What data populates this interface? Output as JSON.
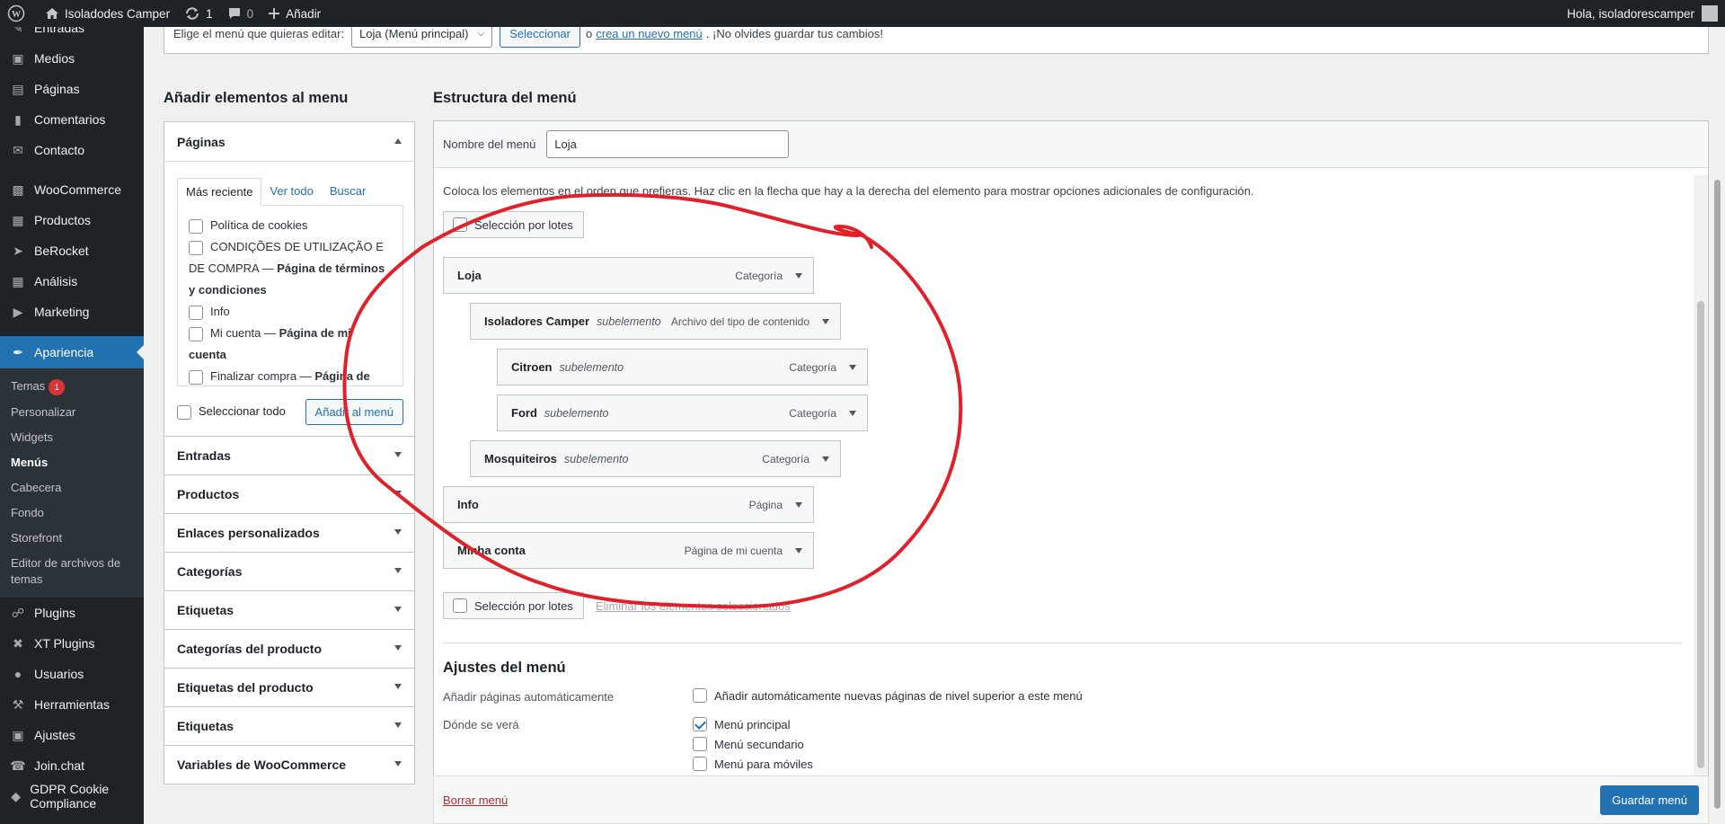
{
  "adminbar": {
    "site_name": "Isoladodes Camper",
    "updates_count": "1",
    "comments_count": "0",
    "new_label": "Añadir",
    "greeting": "Hola, isoladorescamper"
  },
  "sidebar": {
    "items_top": [
      {
        "label": "Entradas",
        "icon": "pin-icon"
      },
      {
        "label": "Medios",
        "icon": "media-icon"
      },
      {
        "label": "Páginas",
        "icon": "page-icon"
      },
      {
        "label": "Comentarios",
        "icon": "comment-icon"
      },
      {
        "label": "Contacto",
        "icon": "mail-icon"
      }
    ],
    "items_mid": [
      {
        "label": "WooCommerce",
        "icon": "woo-icon"
      },
      {
        "label": "Productos",
        "icon": "archive-icon"
      },
      {
        "label": "BeRocket",
        "icon": "rocket-icon"
      },
      {
        "label": "Análisis",
        "icon": "chart-icon"
      },
      {
        "label": "Marketing",
        "icon": "megaphone-icon"
      }
    ],
    "current": {
      "label": "Apariencia",
      "icon": "brush-icon"
    },
    "submenu": [
      {
        "label": "Temas",
        "badge": "1"
      },
      {
        "label": "Personalizar"
      },
      {
        "label": "Widgets"
      },
      {
        "label": "Menús"
      },
      {
        "label": "Cabecera"
      },
      {
        "label": "Fondo"
      },
      {
        "label": "Storefront"
      },
      {
        "label": "Editor de archivos de temas"
      }
    ],
    "items_bottom": [
      {
        "label": "Plugins",
        "icon": "plugin-icon"
      },
      {
        "label": "XT Plugins",
        "icon": "xt-icon"
      },
      {
        "label": "Usuarios",
        "icon": "user-icon"
      },
      {
        "label": "Herramientas",
        "icon": "wrench-icon"
      },
      {
        "label": "Ajustes",
        "icon": "settings-icon"
      },
      {
        "label": "Join.chat",
        "icon": "chat-icon"
      },
      {
        "label": "GDPR Cookie Compliance",
        "icon": "gdpr-icon"
      }
    ]
  },
  "topbox": {
    "prompt": "Elige el menú que quieras editar:",
    "selected_menu": "Loja (Menú principal)",
    "select_button": "Seleccionar",
    "or": "o",
    "create_link": "crea un nuevo menú",
    "reminder": ". ¡No olvides guardar tus cambios!"
  },
  "left": {
    "heading": "Añadir elementos al menu",
    "pages_section": "Páginas",
    "tabs": [
      "Más reciente",
      "Ver todo",
      "Buscar"
    ],
    "page_items": [
      {
        "text": "Política de cookies",
        "suffix": ""
      },
      {
        "text": "CONDIÇÕES DE UTILIZAÇÃO E DE COMPRA — ",
        "suffix": "Página de términos y condiciones"
      },
      {
        "text": "Info",
        "suffix": ""
      },
      {
        "text": "Mi cuenta — ",
        "suffix": "Página de mi cuenta"
      },
      {
        "text": "Finalizar compra — ",
        "suffix": "Página de pago"
      }
    ],
    "select_all": "Seleccionar todo",
    "add_button": "Añadir al menú",
    "sections": [
      "Entradas",
      "Productos",
      "Enlaces personalizados",
      "Categorías",
      "Etiquetas",
      "Categorías del producto",
      "Etiquetas del producto",
      "Etiquetas",
      "Variables de WooCommerce"
    ]
  },
  "right": {
    "heading": "Estructura del menú",
    "name_label": "Nombre del menú",
    "name_value": "Loja",
    "instructions": "Coloca los elementos en el orden que prefieras. Haz clic en la flecha que hay a la derecha del elemento para mostrar opciones adicionales de configuración.",
    "bulk_label": "Selección por lotes",
    "remove_selected": "Eliminar los elementos seleccionados",
    "items": [
      {
        "title": "Loja",
        "sub": "",
        "type": "Categoría",
        "depth": 0
      },
      {
        "title": "Isoladores Camper",
        "sub": "subelemento",
        "type": "Archivo del tipo de contenido",
        "depth": 1
      },
      {
        "title": "Citroen",
        "sub": "subelemento",
        "type": "Categoría",
        "depth": 2
      },
      {
        "title": "Ford",
        "sub": "subelemento",
        "type": "Categoría",
        "depth": 2
      },
      {
        "title": "Mosquiteiros",
        "sub": "subelemento",
        "type": "Categoría",
        "depth": 1
      },
      {
        "title": "Info",
        "sub": "",
        "type": "Página",
        "depth": 0
      },
      {
        "title": "Minha conta",
        "sub": "",
        "type": "Página de mi cuenta",
        "depth": 0
      }
    ],
    "settings_heading": "Ajustes del menú",
    "auto_add_label": "Añadir páginas automáticamente",
    "auto_add_option": "Añadir automáticamente nuevas páginas de nivel superior a este menú",
    "location_label": "Dónde se verá",
    "locations": [
      {
        "label": "Menú principal",
        "checked": true
      },
      {
        "label": "Menú secundario",
        "checked": false
      },
      {
        "label": "Menú para móviles",
        "checked": false
      }
    ],
    "delete_link": "Borrar menú",
    "save_button": "Guardar menú"
  },
  "colors": {
    "accent": "#2271b1",
    "sidebar": "#1d2327",
    "annotation": "#e0202a"
  }
}
